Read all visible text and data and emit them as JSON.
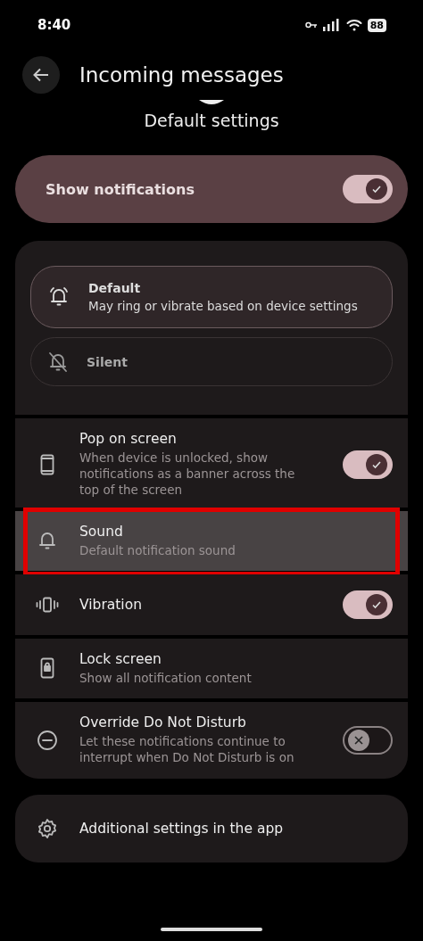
{
  "status_bar": {
    "time": "8:40",
    "battery": "88"
  },
  "header": {
    "title": "Incoming messages",
    "subtitle": "Default settings"
  },
  "master": {
    "label": "Show notifications",
    "on": true
  },
  "modes": [
    {
      "title": "Default",
      "description": "May ring or vibrate based on device settings",
      "selected": true
    },
    {
      "title": "Silent",
      "selected": false
    }
  ],
  "rows": [
    {
      "kind": "toggle",
      "title": "Pop on screen",
      "description": "When device is unlocked, show notifications as a banner across the top of the screen",
      "on": true,
      "highlighted": false
    },
    {
      "kind": "link",
      "title": "Sound",
      "description": "Default notification sound",
      "highlighted": true
    },
    {
      "kind": "toggle",
      "title": "Vibration",
      "on": true,
      "highlighted": false
    },
    {
      "kind": "link",
      "title": "Lock screen",
      "description": "Show all notification content",
      "highlighted": false
    },
    {
      "kind": "toggle",
      "title": "Override Do Not Disturb",
      "description": "Let these notifications continue to interrupt when Do Not Disturb is on",
      "on": false,
      "highlighted": false
    }
  ],
  "footer": {
    "title": "Additional settings in the app"
  }
}
